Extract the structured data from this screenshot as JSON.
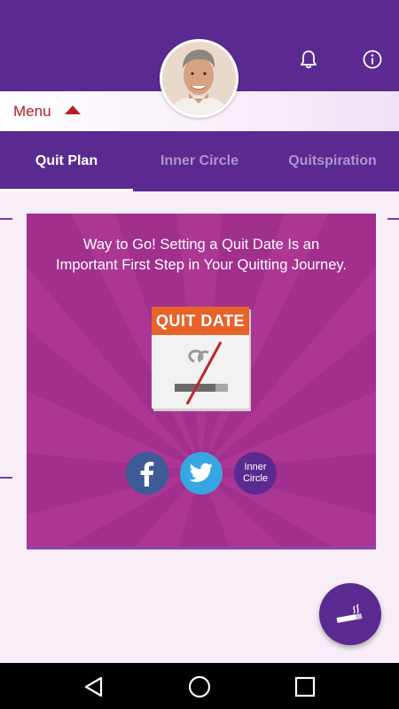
{
  "header": {
    "menu_label": "Menu"
  },
  "tabs": [
    {
      "label": "Quit Plan",
      "active": true
    },
    {
      "label": "Inner Circle",
      "active": false
    },
    {
      "label": "Quitspiration",
      "active": false
    }
  ],
  "card": {
    "message_line1": "Way to Go! Setting a Quit Date Is an",
    "message_line2": "Important First Step in Your Quitting Journey.",
    "calendar_title": "QUIT DATE"
  },
  "share": {
    "inner_circle_line1": "Inner",
    "inner_circle_line2": "Circle"
  },
  "icons": {
    "bell": "bell-icon",
    "info": "info-icon",
    "facebook": "facebook-icon",
    "twitter": "twitter-icon",
    "fab": "cigarette-icon",
    "back": "back-triangle-icon",
    "home": "home-circle-icon",
    "recent": "recent-square-icon"
  },
  "colors": {
    "primary": "#5b2a91",
    "card": "#a12f8d",
    "menu": "#b51d28",
    "calendar_header": "#e8632a",
    "facebook": "#3c5b97",
    "twitter": "#36a7e3"
  }
}
